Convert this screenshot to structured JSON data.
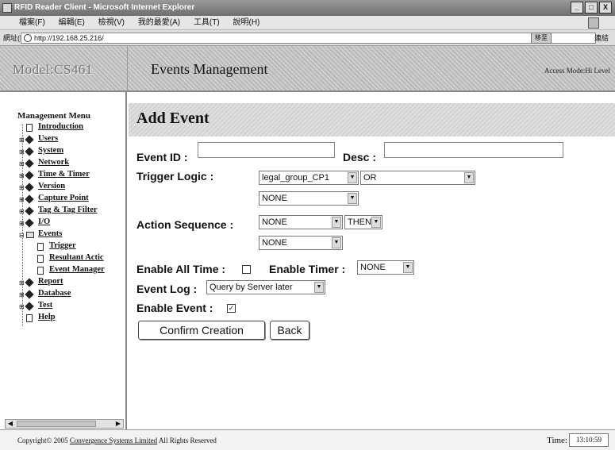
{
  "window": {
    "title": "RFID Reader Client - Microsoft Internet Explorer",
    "controls": {
      "minimize": "_",
      "maximize": "□",
      "close": "X"
    }
  },
  "menubar": {
    "items": [
      "檔案(F)",
      "編輯(E)",
      "檢視(V)",
      "我的最愛(A)",
      "工具(T)",
      "說明(H)"
    ]
  },
  "addressbar": {
    "label": "網址(D)",
    "url": "http://192.168.25.216/",
    "go": "移至",
    "links": "連結"
  },
  "header": {
    "model": "Model:CS461",
    "title": "Events Management",
    "access": "Access Mode:Hi Level"
  },
  "sidebar": {
    "title": "Management Menu",
    "items": [
      {
        "label": "Introduction",
        "icon": "document-icon",
        "indent": 0
      },
      {
        "label": "Users",
        "icon": "diamond-icon",
        "indent": 0
      },
      {
        "label": "System",
        "icon": "diamond-icon",
        "indent": 0
      },
      {
        "label": "Network",
        "icon": "diamond-icon",
        "indent": 0
      },
      {
        "label": "Time & Timer",
        "icon": "diamond-icon",
        "indent": 0
      },
      {
        "label": "Version",
        "icon": "diamond-icon",
        "indent": 0
      },
      {
        "label": "Capture Point",
        "icon": "diamond-icon",
        "indent": 0
      },
      {
        "label": "Tag & Tag Filter",
        "icon": "diamond-icon",
        "indent": 0
      },
      {
        "label": "I/O",
        "icon": "diamond-icon",
        "indent": 0
      },
      {
        "label": "Events",
        "icon": "folder-open-icon",
        "indent": 0
      },
      {
        "label": "Trigger",
        "icon": "document-icon",
        "indent": 1
      },
      {
        "label": "Resultant Actic",
        "icon": "document-icon",
        "indent": 1
      },
      {
        "label": "Event Manager",
        "icon": "document-icon",
        "indent": 1
      },
      {
        "label": "Report",
        "icon": "diamond-icon",
        "indent": 0
      },
      {
        "label": "Database",
        "icon": "diamond-icon",
        "indent": 0
      },
      {
        "label": "Test",
        "icon": "diamond-icon",
        "indent": 0
      },
      {
        "label": "Help",
        "icon": "document-icon",
        "indent": 0
      }
    ]
  },
  "form": {
    "heading": "Add Event",
    "event_id_label": "Event ID :",
    "event_id_value": "",
    "desc_label": "Desc :",
    "desc_value": "",
    "trigger_logic_label": "Trigger Logic :",
    "trigger_1": "legal_group_CP1",
    "trigger_op": "OR",
    "trigger_2": "NONE",
    "action_sequence_label": "Action Sequence :",
    "action_1": "NONE",
    "action_op": "THEN",
    "action_2": "NONE",
    "enable_all_time_label": "Enable All Time :",
    "enable_all_time_checked": false,
    "enable_timer_label": "Enable Timer :",
    "enable_timer_value": "NONE",
    "event_log_label": "Event Log :",
    "event_log_value": "Query by Server later",
    "enable_event_label": "Enable Event :",
    "enable_event_checked": true,
    "confirm_label": "Confirm Creation",
    "back_label": "Back"
  },
  "footer": {
    "copyright_prefix": "Copyright© 2005",
    "company": "Convergence Systems Limited",
    "rights": "All Rights Reserved",
    "time_label": "Time:",
    "time_value": "13:10:59"
  },
  "icons": {
    "checkbox_checked": "☑",
    "checkbox_unchecked": "☐",
    "select_caret": "▼"
  }
}
